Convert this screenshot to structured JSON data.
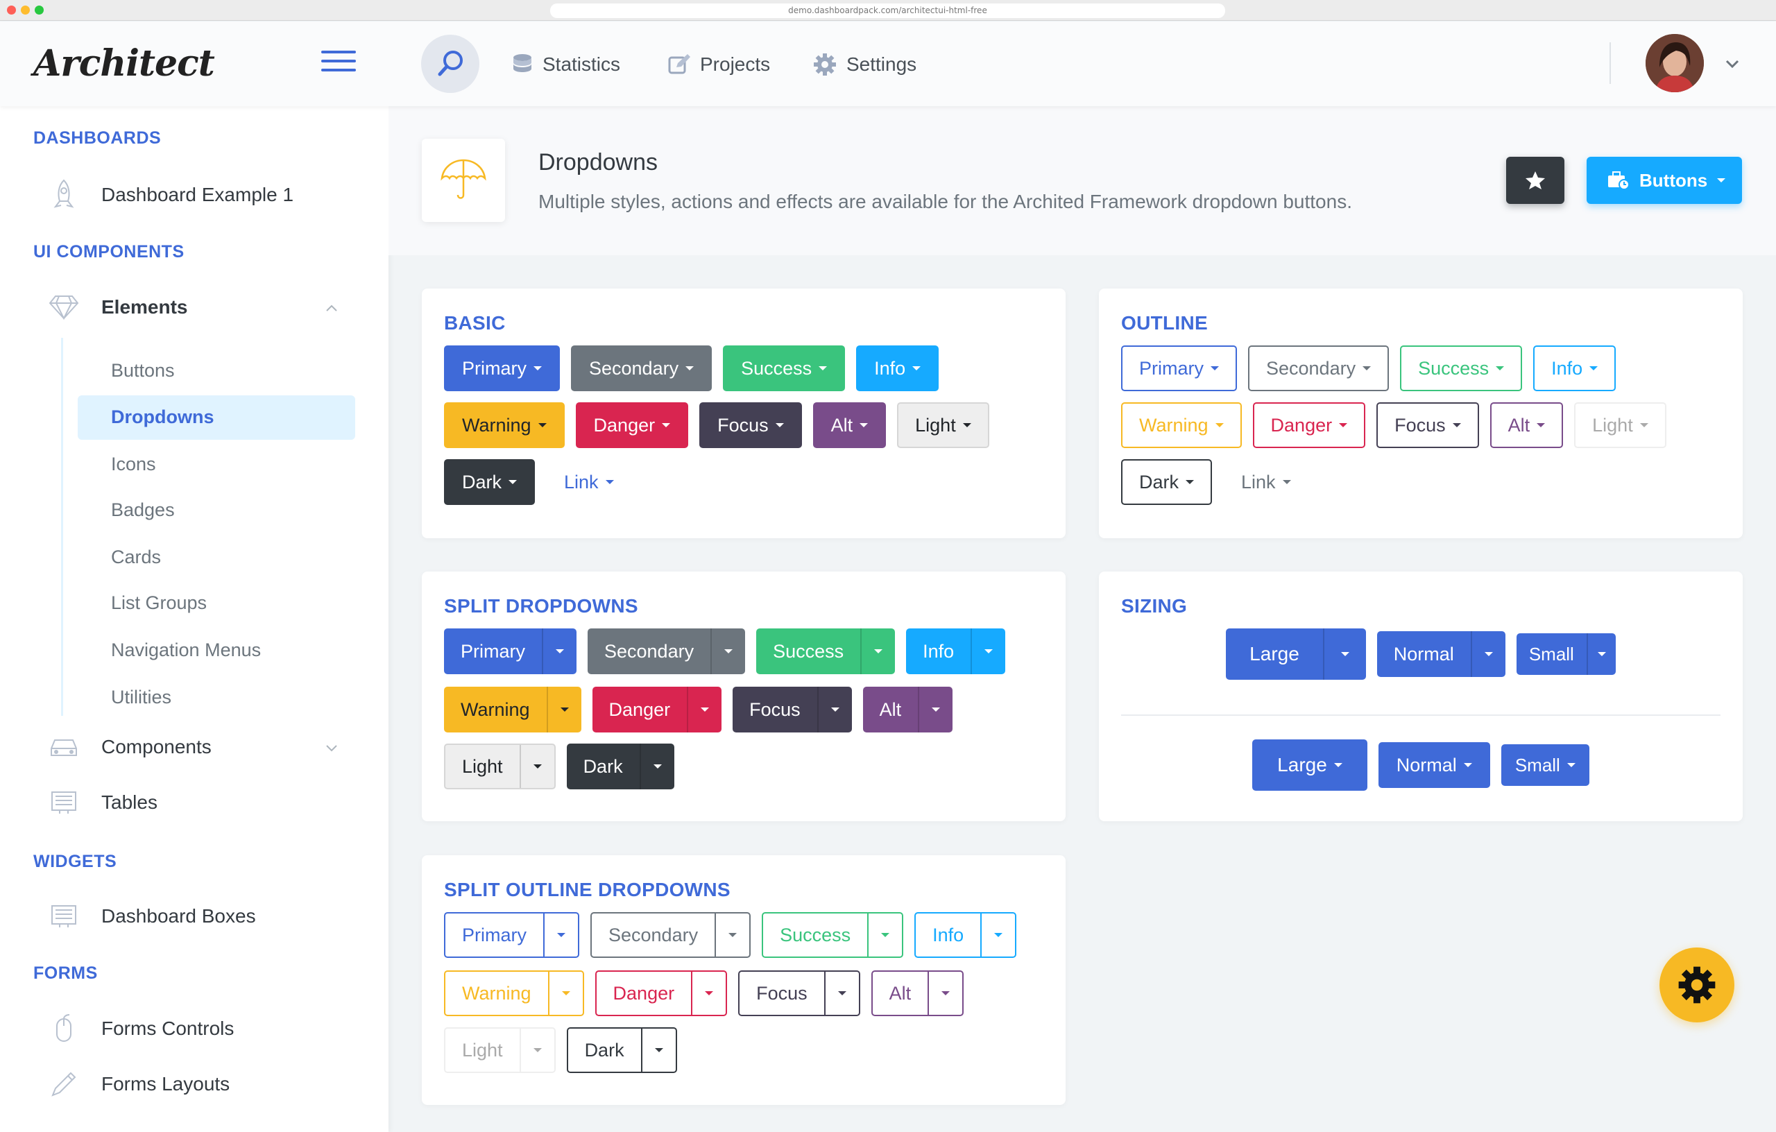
{
  "browser": {
    "url": "demo.dashboardpack.com/architectui-html-free"
  },
  "header": {
    "logo": "Architect",
    "nav": [
      {
        "label": "Statistics",
        "icon": "database-icon"
      },
      {
        "label": "Projects",
        "icon": "edit-icon"
      },
      {
        "label": "Settings",
        "icon": "gear-icon"
      }
    ]
  },
  "sidebar": {
    "sections": {
      "dashboards": "DASHBOARDS",
      "ui": "UI COMPONENTS",
      "widgets": "WIDGETS",
      "forms": "FORMS"
    },
    "items": {
      "dashboard1": "Dashboard Example 1",
      "elements": "Elements",
      "components": "Components",
      "tables": "Tables",
      "dashboard_boxes": "Dashboard Boxes",
      "forms_controls": "Forms Controls",
      "forms_layouts": "Forms Layouts"
    },
    "sub": [
      "Buttons",
      "Dropdowns",
      "Icons",
      "Badges",
      "Cards",
      "List Groups",
      "Navigation Menus",
      "Utilities"
    ]
  },
  "page": {
    "title": "Dropdowns",
    "subtitle": "Multiple styles, actions and effects are available for the Archited Framework dropdown buttons.",
    "buttons_label": "Buttons"
  },
  "cards": {
    "basic": "BASIC",
    "outline": "OUTLINE",
    "split": "SPLIT DROPDOWNS",
    "sizing": "SIZING",
    "split_outline": "SPLIT OUTLINE DROPDOWNS"
  },
  "labels": {
    "primary": "Primary",
    "secondary": "Secondary",
    "success": "Success",
    "info": "Info",
    "warning": "Warning",
    "danger": "Danger",
    "focus": "Focus",
    "alt": "Alt",
    "light": "Light",
    "dark": "Dark",
    "link": "Link",
    "large": "Large",
    "normal": "Normal",
    "small": "Small"
  },
  "colors": {
    "primary": "#3f6ad8",
    "secondary": "#6c757d",
    "success": "#3ac47d",
    "info": "#16aaff",
    "warning": "#f7b924",
    "danger": "#d92550",
    "focus": "#444054",
    "alt": "#794c8a",
    "light": "#eeeeee",
    "dark": "#343a40"
  }
}
